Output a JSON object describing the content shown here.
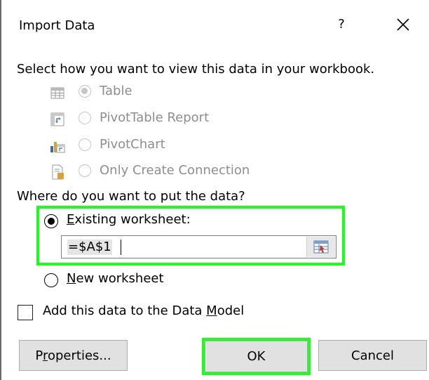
{
  "dialog": {
    "title": "Import Data",
    "help_label": "?",
    "prompt": "Select how you want to view this data in your workbook.",
    "view_options": [
      {
        "label": "Table",
        "selected": true,
        "icon": "table-icon"
      },
      {
        "label": "PivotTable Report",
        "selected": false,
        "icon": "pivottable-icon"
      },
      {
        "label": "PivotChart",
        "selected": false,
        "icon": "pivotchart-icon"
      },
      {
        "label": "Only Create Connection",
        "selected": false,
        "icon": "connection-icon"
      }
    ],
    "where_prompt": "Where do you want to put the data?",
    "existing_worksheet": {
      "prefix": "",
      "access_key": "E",
      "rest": "xisting worksheet:",
      "selected": true
    },
    "cell_reference": "=$A$1",
    "new_worksheet": {
      "access_key": "N",
      "rest": "ew worksheet",
      "selected": false
    },
    "data_model": {
      "before": "Add this data to the Data ",
      "access_key": "M",
      "after": "odel",
      "checked": false
    },
    "buttons": {
      "properties": {
        "before": "P",
        "access_key": "r",
        "after": "operties..."
      },
      "ok": "OK",
      "cancel": "Cancel"
    },
    "colors": {
      "highlight": "#1cff1c",
      "disabled_text": "#8e8e8e",
      "button_bg": "#e1e1e1"
    }
  }
}
